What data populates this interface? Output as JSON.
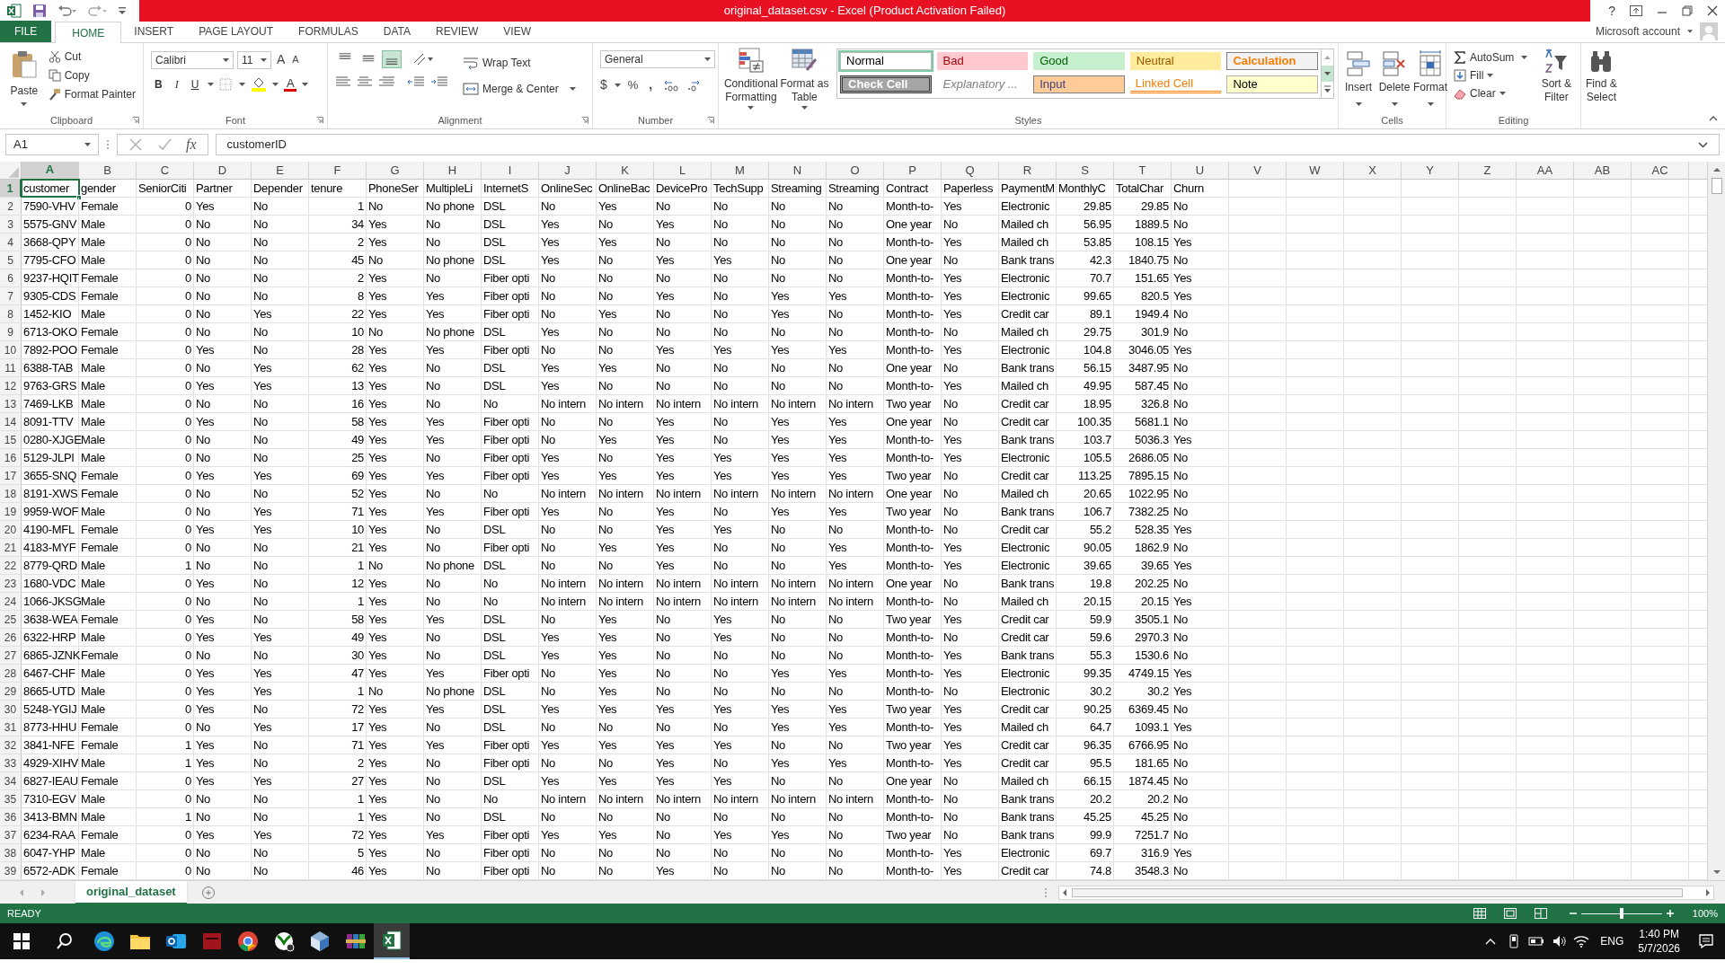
{
  "window": {
    "title": "original_dataset.csv - Excel (Product Activation Failed)",
    "help": "?"
  },
  "tabs": [
    {
      "label": "FILE",
      "kind": "file",
      "selected": false
    },
    {
      "label": "HOME",
      "kind": "tab",
      "selected": true
    },
    {
      "label": "INSERT",
      "kind": "tab",
      "selected": false
    },
    {
      "label": "PAGE LAYOUT",
      "kind": "tab",
      "selected": false
    },
    {
      "label": "FORMULAS",
      "kind": "tab",
      "selected": false
    },
    {
      "label": "DATA",
      "kind": "tab",
      "selected": false
    },
    {
      "label": "REVIEW",
      "kind": "tab",
      "selected": false
    },
    {
      "label": "VIEW",
      "kind": "tab",
      "selected": false
    }
  ],
  "account": "Microsoft account",
  "ribbon": {
    "clipboard": {
      "label": "Clipboard",
      "paste": "Paste",
      "cut": "Cut",
      "copy": "Copy",
      "format_painter": "Format Painter"
    },
    "font": {
      "label": "Font",
      "name": "Calibri",
      "size": "11",
      "grow": "A",
      "shrink": "A",
      "bold": "B",
      "italic": "I",
      "underline": "U",
      "font_color": "A"
    },
    "alignment": {
      "label": "Alignment",
      "vertical": [
        {
          "kind": "top",
          "selected": false
        },
        {
          "kind": "middle",
          "selected": false
        },
        {
          "kind": "bottom",
          "selected": true
        }
      ],
      "wrap": "Wrap Text",
      "merge": "Merge & Center"
    },
    "number": {
      "label": "Number",
      "format": "General",
      "currency": "$",
      "percent": "%",
      "comma": ","
    },
    "conditional": "Conditional Formatting",
    "format_table": "Format as Table",
    "styles": {
      "label": "Styles",
      "items": [
        {
          "label": "Normal",
          "kind": "normal",
          "selected": true
        },
        {
          "label": "Bad",
          "kind": "bad",
          "selected": false
        },
        {
          "label": "Good",
          "kind": "good",
          "selected": false
        },
        {
          "label": "Neutral",
          "kind": "neutral",
          "selected": false
        },
        {
          "label": "Calculation",
          "kind": "calculation",
          "selected": false
        },
        {
          "label": "Check Cell",
          "kind": "check",
          "selected": false
        },
        {
          "label": "Explanatory ...",
          "kind": "explanatory",
          "selected": false
        },
        {
          "label": "Input",
          "kind": "input",
          "selected": false
        },
        {
          "label": "Linked Cell",
          "kind": "linked",
          "selected": false
        },
        {
          "label": "Note",
          "kind": "note",
          "selected": false
        }
      ]
    },
    "cells": {
      "label": "Cells",
      "insert": "Insert",
      "delete": "Delete",
      "format": "Format"
    },
    "editing": {
      "label": "Editing",
      "autosum": "AutoSum",
      "fill": "Fill",
      "clear": "Clear",
      "sort": "Sort & Filter",
      "find": "Find & Select"
    }
  },
  "formula_bar": {
    "name_box": "A1",
    "value": "customerID",
    "fx": "fx"
  },
  "grid": {
    "columns": [
      {
        "letter": "A",
        "kind": "text",
        "selected": true
      },
      {
        "letter": "B",
        "kind": "text",
        "selected": false
      },
      {
        "letter": "C",
        "kind": "number",
        "selected": false
      },
      {
        "letter": "D",
        "kind": "text",
        "selected": false
      },
      {
        "letter": "E",
        "kind": "text",
        "selected": false
      },
      {
        "letter": "F",
        "kind": "number",
        "selected": false
      },
      {
        "letter": "G",
        "kind": "text",
        "selected": false
      },
      {
        "letter": "H",
        "kind": "text",
        "selected": false
      },
      {
        "letter": "I",
        "kind": "text",
        "selected": false
      },
      {
        "letter": "J",
        "kind": "text",
        "selected": false
      },
      {
        "letter": "K",
        "kind": "text",
        "selected": false
      },
      {
        "letter": "L",
        "kind": "text",
        "selected": false
      },
      {
        "letter": "M",
        "kind": "text",
        "selected": false
      },
      {
        "letter": "N",
        "kind": "text",
        "selected": false
      },
      {
        "letter": "O",
        "kind": "text",
        "selected": false
      },
      {
        "letter": "P",
        "kind": "text",
        "selected": false
      },
      {
        "letter": "Q",
        "kind": "text",
        "selected": false
      },
      {
        "letter": "R",
        "kind": "text",
        "selected": false
      },
      {
        "letter": "S",
        "kind": "number",
        "selected": false
      },
      {
        "letter": "T",
        "kind": "number",
        "selected": false
      },
      {
        "letter": "U",
        "kind": "text",
        "selected": false
      },
      {
        "letter": "V",
        "selected": false
      },
      {
        "letter": "W",
        "selected": false
      },
      {
        "letter": "X",
        "selected": false
      },
      {
        "letter": "Y",
        "selected": false
      },
      {
        "letter": "Z",
        "selected": false
      },
      {
        "letter": "AA",
        "selected": false
      },
      {
        "letter": "AB",
        "selected": false
      },
      {
        "letter": "AC",
        "selected": false
      }
    ],
    "rows": [
      {
        "number": "1",
        "kind": "header",
        "selected": true,
        "cells": [
          "customer",
          "gender",
          "SeniorCiti",
          "Partner",
          "Depender",
          "tenure",
          "PhoneSer",
          "MultipleLi",
          "InternetS",
          "OnlineSec",
          "OnlineBac",
          "DevicePro",
          "TechSupp",
          "Streaming",
          "Streaming",
          "Contract",
          "Paperless",
          "PaymentM",
          "MonthlyC",
          "TotalChar",
          "Churn"
        ]
      },
      {
        "number": "2",
        "kind": "record",
        "selected": false,
        "cells": [
          "7590-VHV",
          "Female",
          "0",
          "Yes",
          "No",
          "1",
          "No",
          "No phone",
          "DSL",
          "No",
          "Yes",
          "No",
          "No",
          "No",
          "No",
          "Month-to-",
          "Yes",
          "Electronic",
          "29.85",
          "29.85",
          "No"
        ]
      },
      {
        "number": "3",
        "kind": "record",
        "selected": false,
        "cells": [
          "5575-GNV",
          "Male",
          "0",
          "No",
          "No",
          "34",
          "Yes",
          "No",
          "DSL",
          "Yes",
          "No",
          "Yes",
          "No",
          "No",
          "No",
          "One year",
          "No",
          "Mailed ch",
          "56.95",
          "1889.5",
          "No"
        ]
      },
      {
        "number": "4",
        "kind": "record",
        "selected": false,
        "cells": [
          "3668-QPY",
          "Male",
          "0",
          "No",
          "No",
          "2",
          "Yes",
          "No",
          "DSL",
          "Yes",
          "Yes",
          "No",
          "No",
          "No",
          "No",
          "Month-to-",
          "Yes",
          "Mailed ch",
          "53.85",
          "108.15",
          "Yes"
        ]
      },
      {
        "number": "5",
        "kind": "record",
        "selected": false,
        "cells": [
          "7795-CFO",
          "Male",
          "0",
          "No",
          "No",
          "45",
          "No",
          "No phone",
          "DSL",
          "Yes",
          "No",
          "Yes",
          "Yes",
          "No",
          "No",
          "One year",
          "No",
          "Bank trans",
          "42.3",
          "1840.75",
          "No"
        ]
      },
      {
        "number": "6",
        "kind": "record",
        "selected": false,
        "cells": [
          "9237-HQIT",
          "Female",
          "0",
          "No",
          "No",
          "2",
          "Yes",
          "No",
          "Fiber opti",
          "No",
          "No",
          "No",
          "No",
          "No",
          "No",
          "Month-to-",
          "Yes",
          "Electronic",
          "70.7",
          "151.65",
          "Yes"
        ]
      },
      {
        "number": "7",
        "kind": "record",
        "selected": false,
        "cells": [
          "9305-CDS",
          "Female",
          "0",
          "No",
          "No",
          "8",
          "Yes",
          "Yes",
          "Fiber opti",
          "No",
          "No",
          "Yes",
          "No",
          "Yes",
          "Yes",
          "Month-to-",
          "Yes",
          "Electronic",
          "99.65",
          "820.5",
          "Yes"
        ]
      },
      {
        "number": "8",
        "kind": "record",
        "selected": false,
        "cells": [
          "1452-KIO",
          "Male",
          "0",
          "No",
          "Yes",
          "22",
          "Yes",
          "Yes",
          "Fiber opti",
          "No",
          "Yes",
          "No",
          "No",
          "Yes",
          "No",
          "Month-to-",
          "Yes",
          "Credit car",
          "89.1",
          "1949.4",
          "No"
        ]
      },
      {
        "number": "9",
        "kind": "record",
        "selected": false,
        "cells": [
          "6713-OKO",
          "Female",
          "0",
          "No",
          "No",
          "10",
          "No",
          "No phone",
          "DSL",
          "Yes",
          "No",
          "No",
          "No",
          "No",
          "No",
          "Month-to-",
          "No",
          "Mailed ch",
          "29.75",
          "301.9",
          "No"
        ]
      },
      {
        "number": "10",
        "kind": "record",
        "selected": false,
        "cells": [
          "7892-POO",
          "Female",
          "0",
          "Yes",
          "No",
          "28",
          "Yes",
          "Yes",
          "Fiber opti",
          "No",
          "No",
          "Yes",
          "Yes",
          "Yes",
          "Yes",
          "Month-to-",
          "Yes",
          "Electronic",
          "104.8",
          "3046.05",
          "Yes"
        ]
      },
      {
        "number": "11",
        "kind": "record",
        "selected": false,
        "cells": [
          "6388-TAB",
          "Male",
          "0",
          "No",
          "Yes",
          "62",
          "Yes",
          "No",
          "DSL",
          "Yes",
          "Yes",
          "No",
          "No",
          "No",
          "No",
          "One year",
          "No",
          "Bank trans",
          "56.15",
          "3487.95",
          "No"
        ]
      },
      {
        "number": "12",
        "kind": "record",
        "selected": false,
        "cells": [
          "9763-GRS",
          "Male",
          "0",
          "Yes",
          "Yes",
          "13",
          "Yes",
          "No",
          "DSL",
          "Yes",
          "No",
          "No",
          "No",
          "No",
          "No",
          "Month-to-",
          "Yes",
          "Mailed ch",
          "49.95",
          "587.45",
          "No"
        ]
      },
      {
        "number": "13",
        "kind": "record",
        "selected": false,
        "cells": [
          "7469-LKB",
          "Male",
          "0",
          "No",
          "No",
          "16",
          "Yes",
          "No",
          "No",
          "No intern",
          "No intern",
          "No intern",
          "No intern",
          "No intern",
          "No intern",
          "Two year",
          "No",
          "Credit car",
          "18.95",
          "326.8",
          "No"
        ]
      },
      {
        "number": "14",
        "kind": "record",
        "selected": false,
        "cells": [
          "8091-TTV",
          "Male",
          "0",
          "Yes",
          "No",
          "58",
          "Yes",
          "Yes",
          "Fiber opti",
          "No",
          "No",
          "Yes",
          "No",
          "Yes",
          "Yes",
          "One year",
          "No",
          "Credit car",
          "100.35",
          "5681.1",
          "No"
        ]
      },
      {
        "number": "15",
        "kind": "record",
        "selected": false,
        "cells": [
          "0280-XJGE",
          "Male",
          "0",
          "No",
          "No",
          "49",
          "Yes",
          "Yes",
          "Fiber opti",
          "No",
          "Yes",
          "Yes",
          "No",
          "Yes",
          "Yes",
          "Month-to-",
          "Yes",
          "Bank trans",
          "103.7",
          "5036.3",
          "Yes"
        ]
      },
      {
        "number": "16",
        "kind": "record",
        "selected": false,
        "cells": [
          "5129-JLPI",
          "Male",
          "0",
          "No",
          "No",
          "25",
          "Yes",
          "No",
          "Fiber opti",
          "Yes",
          "No",
          "Yes",
          "Yes",
          "Yes",
          "Yes",
          "Month-to-",
          "Yes",
          "Electronic",
          "105.5",
          "2686.05",
          "No"
        ]
      },
      {
        "number": "17",
        "kind": "record",
        "selected": false,
        "cells": [
          "3655-SNQ",
          "Female",
          "0",
          "Yes",
          "Yes",
          "69",
          "Yes",
          "Yes",
          "Fiber opti",
          "Yes",
          "Yes",
          "Yes",
          "Yes",
          "Yes",
          "Yes",
          "Two year",
          "No",
          "Credit car",
          "113.25",
          "7895.15",
          "No"
        ]
      },
      {
        "number": "18",
        "kind": "record",
        "selected": false,
        "cells": [
          "8191-XWS",
          "Female",
          "0",
          "No",
          "No",
          "52",
          "Yes",
          "No",
          "No",
          "No intern",
          "No intern",
          "No intern",
          "No intern",
          "No intern",
          "No intern",
          "One year",
          "No",
          "Mailed ch",
          "20.65",
          "1022.95",
          "No"
        ]
      },
      {
        "number": "19",
        "kind": "record",
        "selected": false,
        "cells": [
          "9959-WOF",
          "Male",
          "0",
          "No",
          "Yes",
          "71",
          "Yes",
          "Yes",
          "Fiber opti",
          "Yes",
          "No",
          "Yes",
          "No",
          "Yes",
          "Yes",
          "Two year",
          "No",
          "Bank trans",
          "106.7",
          "7382.25",
          "No"
        ]
      },
      {
        "number": "20",
        "kind": "record",
        "selected": false,
        "cells": [
          "4190-MFL",
          "Female",
          "0",
          "Yes",
          "Yes",
          "10",
          "Yes",
          "No",
          "DSL",
          "No",
          "No",
          "Yes",
          "Yes",
          "No",
          "No",
          "Month-to-",
          "No",
          "Credit car",
          "55.2",
          "528.35",
          "Yes"
        ]
      },
      {
        "number": "21",
        "kind": "record",
        "selected": false,
        "cells": [
          "4183-MYF",
          "Female",
          "0",
          "No",
          "No",
          "21",
          "Yes",
          "No",
          "Fiber opti",
          "No",
          "Yes",
          "Yes",
          "No",
          "No",
          "Yes",
          "Month-to-",
          "Yes",
          "Electronic",
          "90.05",
          "1862.9",
          "No"
        ]
      },
      {
        "number": "22",
        "kind": "record",
        "selected": false,
        "cells": [
          "8779-QRD",
          "Male",
          "1",
          "No",
          "No",
          "1",
          "No",
          "No phone",
          "DSL",
          "No",
          "No",
          "Yes",
          "No",
          "No",
          "Yes",
          "Month-to-",
          "Yes",
          "Electronic",
          "39.65",
          "39.65",
          "Yes"
        ]
      },
      {
        "number": "23",
        "kind": "record",
        "selected": false,
        "cells": [
          "1680-VDC",
          "Male",
          "0",
          "Yes",
          "No",
          "12",
          "Yes",
          "No",
          "No",
          "No intern",
          "No intern",
          "No intern",
          "No intern",
          "No intern",
          "No intern",
          "One year",
          "No",
          "Bank trans",
          "19.8",
          "202.25",
          "No"
        ]
      },
      {
        "number": "24",
        "kind": "record",
        "selected": false,
        "cells": [
          "1066-JKSG",
          "Male",
          "0",
          "No",
          "No",
          "1",
          "Yes",
          "No",
          "No",
          "No intern",
          "No intern",
          "No intern",
          "No intern",
          "No intern",
          "No intern",
          "Month-to-",
          "No",
          "Mailed ch",
          "20.15",
          "20.15",
          "Yes"
        ]
      },
      {
        "number": "25",
        "kind": "record",
        "selected": false,
        "cells": [
          "3638-WEA",
          "Female",
          "0",
          "Yes",
          "No",
          "58",
          "Yes",
          "Yes",
          "DSL",
          "No",
          "Yes",
          "No",
          "Yes",
          "No",
          "No",
          "Two year",
          "Yes",
          "Credit car",
          "59.9",
          "3505.1",
          "No"
        ]
      },
      {
        "number": "26",
        "kind": "record",
        "selected": false,
        "cells": [
          "6322-HRP",
          "Male",
          "0",
          "Yes",
          "Yes",
          "49",
          "Yes",
          "No",
          "DSL",
          "Yes",
          "Yes",
          "No",
          "Yes",
          "No",
          "No",
          "Month-to-",
          "No",
          "Credit car",
          "59.6",
          "2970.3",
          "No"
        ]
      },
      {
        "number": "27",
        "kind": "record",
        "selected": false,
        "cells": [
          "6865-JZNK",
          "Female",
          "0",
          "No",
          "No",
          "30",
          "Yes",
          "No",
          "DSL",
          "Yes",
          "Yes",
          "No",
          "No",
          "No",
          "No",
          "Month-to-",
          "Yes",
          "Bank trans",
          "55.3",
          "1530.6",
          "No"
        ]
      },
      {
        "number": "28",
        "kind": "record",
        "selected": false,
        "cells": [
          "6467-CHF",
          "Male",
          "0",
          "Yes",
          "Yes",
          "47",
          "Yes",
          "Yes",
          "Fiber opti",
          "No",
          "Yes",
          "No",
          "No",
          "Yes",
          "Yes",
          "Month-to-",
          "Yes",
          "Electronic",
          "99.35",
          "4749.15",
          "Yes"
        ]
      },
      {
        "number": "29",
        "kind": "record",
        "selected": false,
        "cells": [
          "8665-UTD",
          "Male",
          "0",
          "Yes",
          "Yes",
          "1",
          "No",
          "No phone",
          "DSL",
          "No",
          "Yes",
          "No",
          "No",
          "No",
          "No",
          "Month-to-",
          "No",
          "Electronic",
          "30.2",
          "30.2",
          "Yes"
        ]
      },
      {
        "number": "30",
        "kind": "record",
        "selected": false,
        "cells": [
          "5248-YGIJ",
          "Male",
          "0",
          "Yes",
          "No",
          "72",
          "Yes",
          "Yes",
          "DSL",
          "Yes",
          "Yes",
          "Yes",
          "Yes",
          "Yes",
          "Yes",
          "Two year",
          "Yes",
          "Credit car",
          "90.25",
          "6369.45",
          "No"
        ]
      },
      {
        "number": "31",
        "kind": "record",
        "selected": false,
        "cells": [
          "8773-HHU",
          "Female",
          "0",
          "No",
          "Yes",
          "17",
          "Yes",
          "No",
          "DSL",
          "No",
          "No",
          "No",
          "No",
          "Yes",
          "Yes",
          "Month-to-",
          "Yes",
          "Mailed ch",
          "64.7",
          "1093.1",
          "Yes"
        ]
      },
      {
        "number": "32",
        "kind": "record",
        "selected": false,
        "cells": [
          "3841-NFE",
          "Female",
          "1",
          "Yes",
          "No",
          "71",
          "Yes",
          "Yes",
          "Fiber opti",
          "Yes",
          "Yes",
          "Yes",
          "Yes",
          "No",
          "No",
          "Two year",
          "Yes",
          "Credit car",
          "96.35",
          "6766.95",
          "No"
        ]
      },
      {
        "number": "33",
        "kind": "record",
        "selected": false,
        "cells": [
          "4929-XIHV",
          "Male",
          "1",
          "Yes",
          "No",
          "2",
          "Yes",
          "No",
          "Fiber opti",
          "No",
          "No",
          "Yes",
          "No",
          "Yes",
          "Yes",
          "Month-to-",
          "Yes",
          "Credit car",
          "95.5",
          "181.65",
          "No"
        ]
      },
      {
        "number": "34",
        "kind": "record",
        "selected": false,
        "cells": [
          "6827-IEAU",
          "Female",
          "0",
          "Yes",
          "Yes",
          "27",
          "Yes",
          "No",
          "DSL",
          "Yes",
          "Yes",
          "Yes",
          "Yes",
          "No",
          "No",
          "One year",
          "No",
          "Mailed ch",
          "66.15",
          "1874.45",
          "No"
        ]
      },
      {
        "number": "35",
        "kind": "record",
        "selected": false,
        "cells": [
          "7310-EGV",
          "Male",
          "0",
          "No",
          "No",
          "1",
          "Yes",
          "No",
          "No",
          "No intern",
          "No intern",
          "No intern",
          "No intern",
          "No intern",
          "No intern",
          "Month-to-",
          "No",
          "Bank trans",
          "20.2",
          "20.2",
          "No"
        ]
      },
      {
        "number": "36",
        "kind": "record",
        "selected": false,
        "cells": [
          "3413-BMN",
          "Male",
          "1",
          "No",
          "No",
          "1",
          "Yes",
          "No",
          "DSL",
          "No",
          "No",
          "No",
          "No",
          "No",
          "No",
          "Month-to-",
          "No",
          "Bank trans",
          "45.25",
          "45.25",
          "No"
        ]
      },
      {
        "number": "37",
        "kind": "record",
        "selected": false,
        "cells": [
          "6234-RAA",
          "Female",
          "0",
          "Yes",
          "Yes",
          "72",
          "Yes",
          "Yes",
          "Fiber opti",
          "Yes",
          "Yes",
          "No",
          "Yes",
          "Yes",
          "No",
          "Two year",
          "No",
          "Bank trans",
          "99.9",
          "7251.7",
          "No"
        ]
      },
      {
        "number": "38",
        "kind": "record",
        "selected": false,
        "cells": [
          "6047-YHP",
          "Male",
          "0",
          "No",
          "No",
          "5",
          "Yes",
          "No",
          "Fiber opti",
          "No",
          "No",
          "No",
          "No",
          "No",
          "No",
          "Month-to-",
          "Yes",
          "Electronic",
          "69.7",
          "316.9",
          "Yes"
        ]
      },
      {
        "number": "39",
        "kind": "record",
        "selected": false,
        "cells": [
          "6572-ADK",
          "Female",
          "0",
          "No",
          "No",
          "46",
          "Yes",
          "No",
          "Fiber opti",
          "No",
          "No",
          "Yes",
          "No",
          "No",
          "No",
          "Month-to-",
          "Yes",
          "Credit car",
          "74.8",
          "3548.3",
          "No"
        ]
      }
    ]
  },
  "sheet_tabs": [
    {
      "label": "original_dataset",
      "selected": true
    }
  ],
  "status_bar": {
    "mode": "READY",
    "zoom": "100%",
    "zoom_slider": {
      "level": 0.5
    }
  },
  "taskbar": {
    "apps": [
      {
        "kind": "edge",
        "selected": false
      },
      {
        "kind": "folder",
        "selected": false
      },
      {
        "kind": "mail",
        "selected": false
      },
      {
        "kind": "red",
        "selected": false
      },
      {
        "kind": "chrome",
        "selected": false
      },
      {
        "kind": "xbox",
        "selected": false
      },
      {
        "kind": "cube",
        "selected": false
      },
      {
        "kind": "books",
        "selected": false
      },
      {
        "kind": "excel",
        "selected": true
      }
    ],
    "language": "ENG",
    "time": "1:40 PM",
    "date": "5/7/2026"
  }
}
